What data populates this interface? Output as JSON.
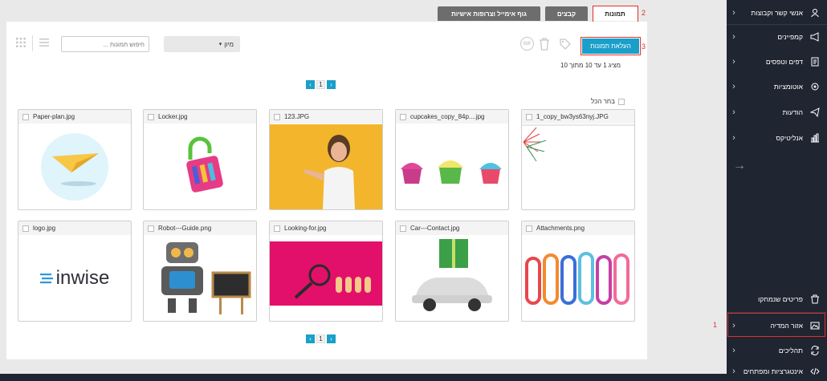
{
  "tabs": [
    {
      "label": "תמונות",
      "active": true
    },
    {
      "label": "קבצים",
      "active": false
    },
    {
      "label": "גוף אימייל וצרופות אישיות",
      "active": false
    }
  ],
  "toolbar": {
    "upload_label": "העלאת תמונות",
    "sort_label": "מיון",
    "search_placeholder": "חיפוש תמונות ...",
    "gif_label": "GIF"
  },
  "count_text": "מציג 1 עד 10 מתוך 10",
  "pager": {
    "page": "1",
    "prev": "‹",
    "next": "›"
  },
  "select_all_label": "בחר הכל",
  "images": [
    {
      "name": "Paper-plan.jpg",
      "icon": "paper-plane"
    },
    {
      "name": "Locker.jpg",
      "icon": "lock"
    },
    {
      "name": "123.JPG",
      "icon": "woman-pointing"
    },
    {
      "name": "cupcakes_copy_84p....jpg",
      "icon": "cupcakes"
    },
    {
      "name": "1_copy_bw3ys63nyj.JPG",
      "icon": "fireworks"
    },
    {
      "name": "logo.jpg",
      "icon": "inwise-logo"
    },
    {
      "name": "Robot---Guide.png",
      "icon": "robot"
    },
    {
      "name": "Looking-for.jpg",
      "icon": "magnifier"
    },
    {
      "name": "Car---Contact.jpg",
      "icon": "car-gift"
    },
    {
      "name": "Attachments.png",
      "icon": "paper-clips"
    }
  ],
  "logo_text": "inwise",
  "sidebar": {
    "items": [
      {
        "label": "אנשי קשר וקבוצות",
        "icon": "contacts-icon"
      },
      {
        "label": "קמפיינים",
        "icon": "megaphone-icon"
      },
      {
        "label": "דפים וטפסים",
        "icon": "page-icon"
      },
      {
        "label": "אוטומציות",
        "icon": "automation-icon"
      },
      {
        "label": "הודעות",
        "icon": "messages-icon"
      },
      {
        "label": "אנליטיקס",
        "icon": "analytics-icon"
      },
      {
        "label": "פריטים שנמחקו",
        "icon": "trash-icon"
      },
      {
        "label": "אזור המדיה",
        "icon": "media-icon"
      },
      {
        "label": "תהליכים",
        "icon": "process-icon"
      },
      {
        "label": "אינטגרציות ומפתחים",
        "icon": "code-icon"
      }
    ],
    "expand_arrow": "→"
  },
  "annotations": [
    "1",
    "2",
    "3"
  ],
  "colors": {
    "accent": "#1a9fc9",
    "sidebar": "#1f2531",
    "highlight": "#e03030"
  }
}
